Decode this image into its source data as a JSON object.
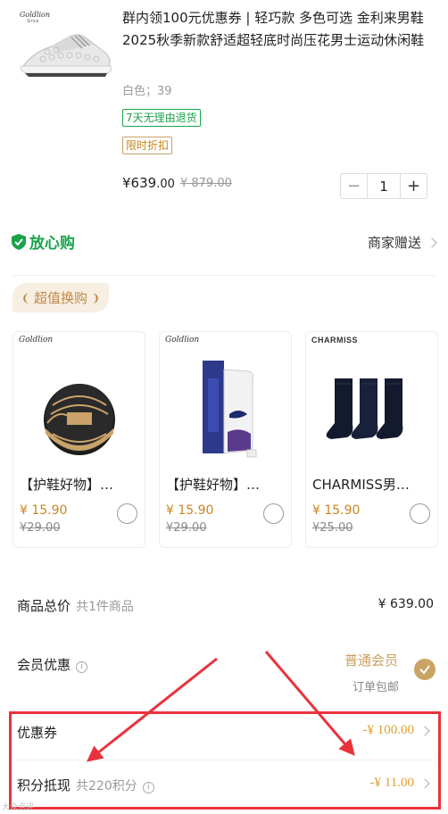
{
  "product": {
    "brand_logo": "Goldlion",
    "brand_logo_sub": "Since",
    "title": "群内领100元优惠券 | 轻巧款 多色可选 金利来男鞋 2025秋季新款舒适超轻底时尚压花男士运动休闲鞋",
    "spec": "白色；39",
    "tag_return": "7天无理由退货",
    "tag_discount": "限时折扣",
    "price_symbol": "¥",
    "price_main": "639",
    "price_decimal": ".00",
    "price_original": "¥ 879.00",
    "quantity": "1",
    "minus": "−",
    "plus": "+"
  },
  "assurance": {
    "label": "放心购",
    "gift_label": "商家赠送"
  },
  "exchange": {
    "badge": "超值换购",
    "items": [
      {
        "brand": "Goldlion",
        "brand_sub": "Since",
        "name": "【护鞋好物】…",
        "price": "¥ 15.90",
        "original": "¥29.00"
      },
      {
        "brand": "Goldlion",
        "brand_sub": "Since",
        "name": "【护鞋好物】…",
        "price": "¥ 15.90",
        "original": "¥29.00"
      },
      {
        "brand": "CHARMISS",
        "brand_sub": "",
        "name": "CHARMISS男…",
        "price": "¥ 15.90",
        "original": "¥25.00"
      }
    ]
  },
  "summary": {
    "total_label": "商品总价",
    "total_sub": "共1件商品",
    "total_value": "¥ 639.00",
    "member_label": "会员优惠",
    "member_level": "普通会员",
    "member_note": "订单包邮",
    "coupon_label": "优惠券",
    "coupon_value": "-¥ 100.00",
    "points_label": "积分抵现",
    "points_sub": "共220积分",
    "points_value": "-¥ 11.00"
  },
  "colors": {
    "green": "#1aa34a",
    "gold": "#c8861e",
    "red_annotation": "#e8333c"
  },
  "watermark": "大众点评"
}
